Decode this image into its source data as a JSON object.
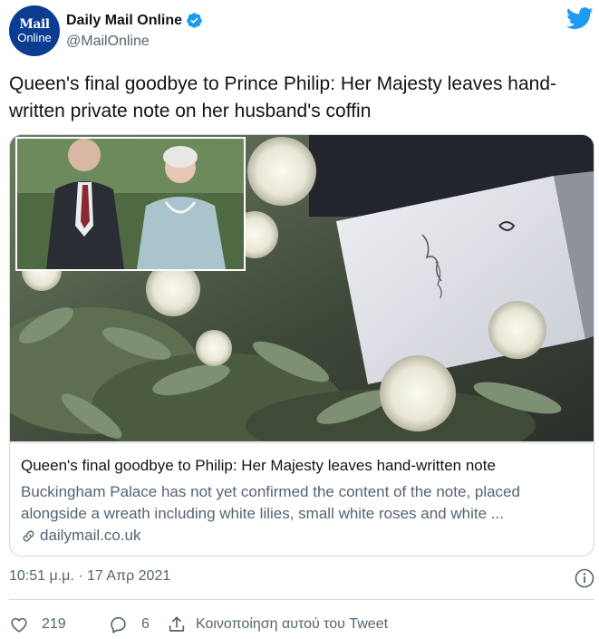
{
  "account": {
    "avatar_line1": "Mail",
    "avatar_line2": "Online",
    "display_name": "Daily Mail Online",
    "handle": "@MailOnline"
  },
  "tweet": {
    "text": "Queen's final goodbye to Prince Philip: Her Majesty leaves hand-written private note on her husband's coffin"
  },
  "card": {
    "title": "Queen's final goodbye to Philip: Her Majesty leaves hand-written note",
    "description": "Buckingham Palace has not yet confirmed the content of the note, placed alongside a wreath including white lilies, small white roses and white ...",
    "domain": "dailymail.co.uk"
  },
  "meta": {
    "timestamp": "10:51 μ.μ. · 17 Απρ 2021"
  },
  "actions": {
    "like_count": "219",
    "reply_count": "6",
    "share_label": "Κοινοποίηση αυτού του Tweet"
  },
  "colors": {
    "twitter_blue": "#1d9bf0",
    "verified_blue": "#1d9bf0",
    "secondary_text": "#536471",
    "border": "#cfd9de",
    "avatar_bg": "#0a3d91"
  },
  "icons": [
    "verified-badge-icon",
    "twitter-bird-icon",
    "link-icon",
    "info-icon",
    "heart-icon",
    "reply-icon",
    "share-icon"
  ]
}
